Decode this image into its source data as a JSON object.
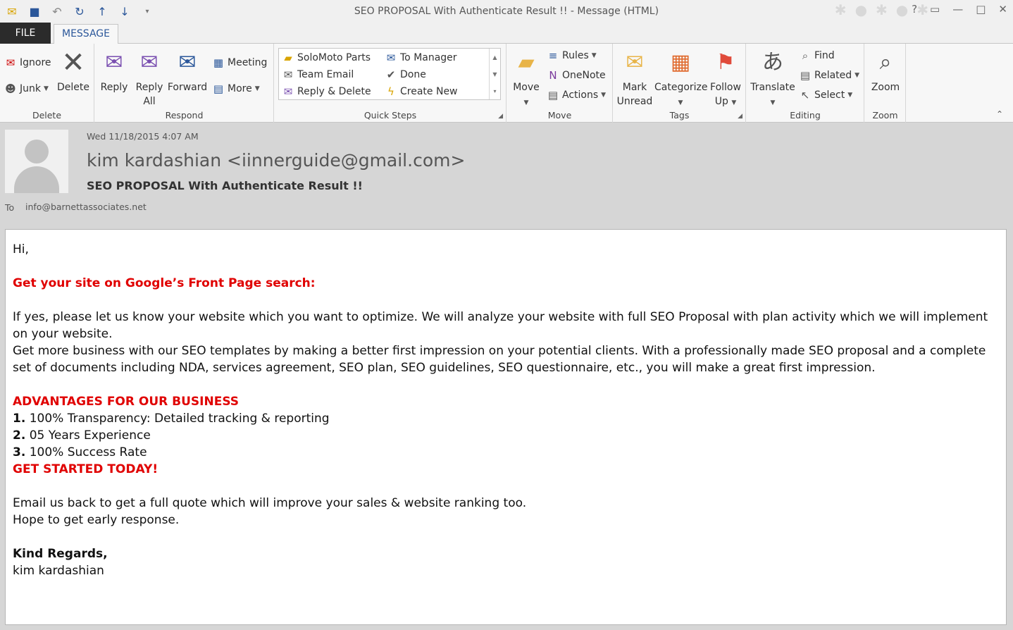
{
  "window": {
    "title": "SEO PROPOSAL With Authenticate Result !! - Message (HTML)"
  },
  "tabs": {
    "file": "FILE",
    "message": "MESSAGE"
  },
  "ribbon": {
    "delete_group": {
      "label": "Delete",
      "ignore": "Ignore",
      "junk": "Junk",
      "delete": "Delete"
    },
    "respond_group": {
      "label": "Respond",
      "reply": "Reply",
      "reply_all_1": "Reply",
      "reply_all_2": "All",
      "forward": "Forward",
      "meeting": "Meeting",
      "more": "More"
    },
    "quick_steps": {
      "label": "Quick Steps",
      "items": [
        "SoloMoto Parts",
        "To Manager",
        "Team Email",
        "Done",
        "Reply & Delete",
        "Create New"
      ]
    },
    "move_group": {
      "label": "Move",
      "move": "Move",
      "rules": "Rules",
      "onenote": "OneNote",
      "actions": "Actions"
    },
    "tags_group": {
      "label": "Tags",
      "mark_unread_1": "Mark",
      "mark_unread_2": "Unread",
      "categorize": "Categorize",
      "follow_up_1": "Follow",
      "follow_up_2": "Up"
    },
    "editing_group": {
      "label": "Editing",
      "translate": "Translate",
      "find": "Find",
      "related": "Related",
      "select": "Select"
    },
    "zoom_group": {
      "label": "Zoom",
      "zoom": "Zoom"
    }
  },
  "header": {
    "date": "Wed 11/18/2015 4:07 AM",
    "sender": "kim kardashian <iinnerguide@gmail.com>",
    "subject": "SEO PROPOSAL With Authenticate Result !!",
    "to_label": "To",
    "to_value": "info@barnettassociates.net"
  },
  "body": {
    "greeting": "Hi,",
    "headline": "Get your site on Google’s Front Page search:",
    "para1": "If yes, please let us know your website which you want to optimize. We will analyze your website with full SEO Proposal with plan activity which we will implement on your website.",
    "para2": "Get more business with our SEO templates by making a better first impression on your potential clients. With a professionally made SEO proposal and a complete set of documents including NDA, services agreement, SEO plan, SEO guidelines, SEO questionnaire, etc., you will make a great first impression.",
    "advantages_title": "ADVANTAGES FOR OUR BUSINESS",
    "advantages": [
      {
        "num": "1.",
        "text": " 100% Transparency: Detailed tracking & reporting"
      },
      {
        "num": "2.",
        "text": " 05 Years Experience"
      },
      {
        "num": "3.",
        "text": " 100% Success Rate"
      }
    ],
    "cta": "GET STARTED TODAY!",
    "line1": "Email us back to get a full quote which will improve your sales & website ranking too.",
    "line2": "Hope to get early response.",
    "regards": "Kind Regards,",
    "signature": "kim kardashian"
  }
}
